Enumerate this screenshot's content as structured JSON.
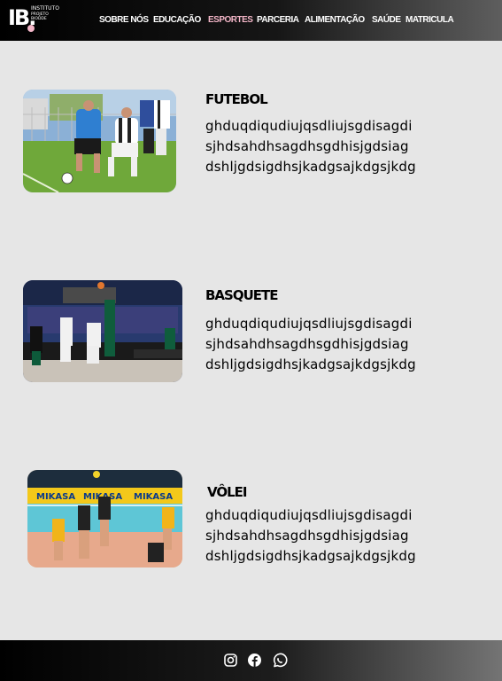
{
  "brand": {
    "mark": "IB.",
    "line1": "INSTITUTO",
    "line2": "PROJETO",
    "line3": "BIODDE"
  },
  "nav": {
    "items": [
      {
        "label": "SOBRE NÓS"
      },
      {
        "label": "EDUCAÇÃO"
      },
      {
        "label": "ESPORTES",
        "active": true
      },
      {
        "label": "PARCERIA"
      },
      {
        "label": "ALIMENTAÇÃO"
      },
      {
        "label": "SAÚDE"
      },
      {
        "label": "MATRICULA"
      }
    ]
  },
  "sports": [
    {
      "title": "FUTEBOL",
      "text": "ghduqdiqudiujqsdliujsgdisagdi sjhdsahdhsagdhsgdhisjgdsiag dshljgdsigdhsjkadgsajkdgsjkdg"
    },
    {
      "title": "BASQUETE",
      "text": "ghduqdiqudiujqsdliujsgdisagdi sjhdsahdhsagdhsgdhisjgdsiag dshljgdsigdhsjkadgsajkdgsjkdg"
    },
    {
      "title": "VÔLEI",
      "text": "ghduqdiqudiujqsdliujsgdisagdi sjhdsahdhsagdhsgdhisjgdsiag dshljgdsigdhsjkadgsajkdgsjkdg"
    }
  ],
  "photos": {
    "volei_banner": "MIKASA"
  },
  "footer": {
    "icons": [
      "instagram-icon",
      "facebook-icon",
      "whatsapp-icon"
    ]
  },
  "colors": {
    "accent": "#f4b6c8",
    "background": "#e6e6e6",
    "header_dark": "#000000"
  }
}
